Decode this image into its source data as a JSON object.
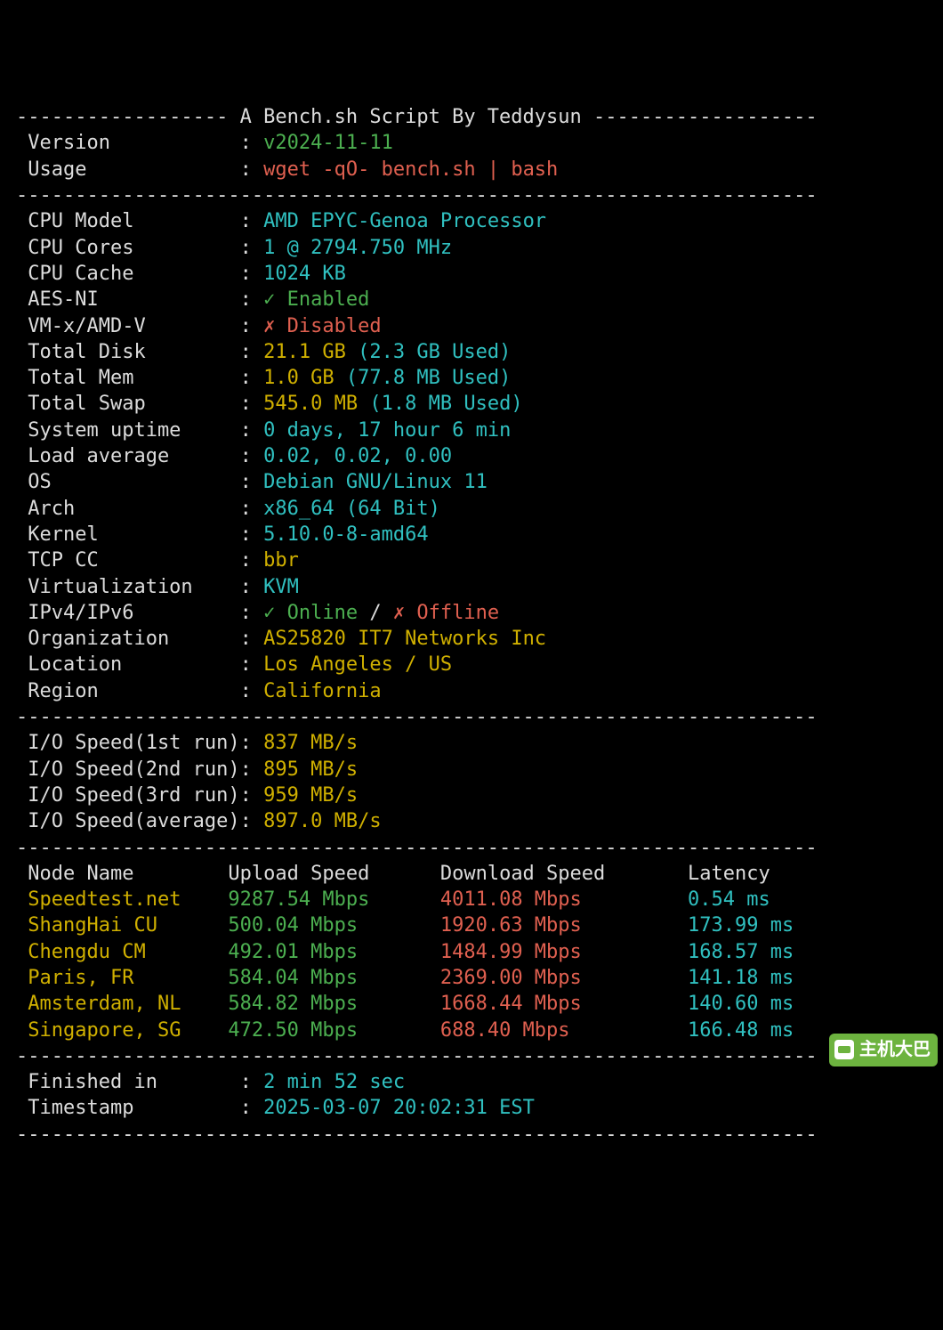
{
  "title": "A Bench.sh Script By Teddysun",
  "meta": {
    "version_label": "Version",
    "version_value": "v2024-11-11",
    "usage_label": "Usage",
    "usage_value": "wget -qO- bench.sh | bash"
  },
  "sysinfo": [
    {
      "label": "CPU Model",
      "value": "AMD EPYC-Genoa Processor",
      "color": "cyan"
    },
    {
      "label": "CPU Cores",
      "value": "1 @ 2794.750 MHz",
      "color": "cyan"
    },
    {
      "label": "CPU Cache",
      "value": "1024 KB",
      "color": "cyan"
    },
    {
      "label": "AES-NI",
      "value": "✓ Enabled",
      "color": "green"
    },
    {
      "label": "VM-x/AMD-V",
      "value": "✗ Disabled",
      "color": "red"
    },
    {
      "label": "Total Disk",
      "value": "21.1 GB",
      "extra": "(2.3 GB Used)",
      "color": "yellow"
    },
    {
      "label": "Total Mem",
      "value": "1.0 GB",
      "extra": "(77.8 MB Used)",
      "color": "yellow"
    },
    {
      "label": "Total Swap",
      "value": "545.0 MB",
      "extra": "(1.8 MB Used)",
      "color": "yellow"
    },
    {
      "label": "System uptime",
      "value": "0 days, 17 hour 6 min",
      "color": "cyan"
    },
    {
      "label": "Load average",
      "value": "0.02, 0.02, 0.00",
      "color": "cyan"
    },
    {
      "label": "OS",
      "value": "Debian GNU/Linux 11",
      "color": "cyan"
    },
    {
      "label": "Arch",
      "value": "x86_64 (64 Bit)",
      "color": "cyan"
    },
    {
      "label": "Kernel",
      "value": "5.10.0-8-amd64",
      "color": "cyan"
    },
    {
      "label": "TCP CC",
      "value": "bbr",
      "color": "yellow"
    },
    {
      "label": "Virtualization",
      "value": "KVM",
      "color": "cyan"
    }
  ],
  "ipv": {
    "label": "IPv4/IPv6",
    "online": "✓ Online",
    "slash": " / ",
    "offline": "✗ Offline"
  },
  "orginfo": [
    {
      "label": "Organization",
      "value": "AS25820 IT7 Networks Inc"
    },
    {
      "label": "Location",
      "value": "Los Angeles / US"
    },
    {
      "label": "Region",
      "value": "California"
    }
  ],
  "io_label_prefix": "I/O Speed",
  "io": [
    {
      "label": "I/O Speed(1st run)",
      "value": "837 MB/s"
    },
    {
      "label": "I/O Speed(2nd run)",
      "value": "895 MB/s"
    },
    {
      "label": "I/O Speed(3rd run)",
      "value": "959 MB/s"
    },
    {
      "label": "I/O Speed(average)",
      "value": "897.0 MB/s"
    }
  ],
  "speed_header": {
    "node": "Node Name",
    "up": "Upload Speed",
    "down": "Download Speed",
    "lat": "Latency"
  },
  "speed": [
    {
      "node": "Speedtest.net",
      "up": "9287.54 Mbps",
      "down": "4011.08 Mbps",
      "lat": "0.54 ms"
    },
    {
      "node": "ShangHai CU",
      "up": "500.04 Mbps",
      "down": "1920.63 Mbps",
      "lat": "173.99 ms"
    },
    {
      "node": "Chengdu CM",
      "up": "492.01 Mbps",
      "down": "1484.99 Mbps",
      "lat": "168.57 ms"
    },
    {
      "node": "Paris, FR",
      "up": "584.04 Mbps",
      "down": "2369.00 Mbps",
      "lat": "141.18 ms"
    },
    {
      "node": "Amsterdam, NL",
      "up": "584.82 Mbps",
      "down": "1668.44 Mbps",
      "lat": "140.60 ms"
    },
    {
      "node": "Singapore, SG",
      "up": "472.50 Mbps",
      "down": "688.40 Mbps",
      "lat": "166.48 ms"
    }
  ],
  "footer": {
    "finished_label": "Finished in",
    "finished_value": "2 min 52 sec",
    "timestamp_label": "Timestamp",
    "timestamp_value": "2025-03-07 20:02:31 EST"
  },
  "watermark": "主机大巴"
}
